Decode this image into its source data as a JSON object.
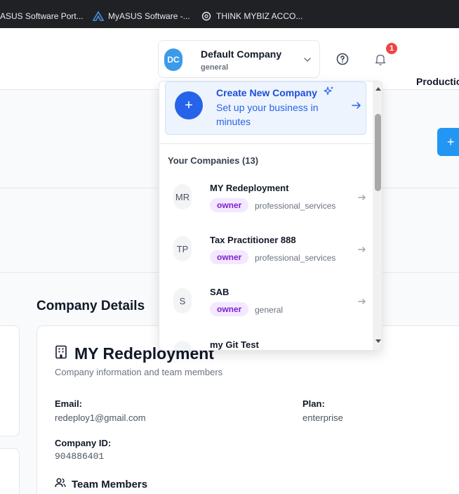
{
  "bookmarks": [
    {
      "label": "ASUS Software Port...",
      "icon": "asus-icon"
    },
    {
      "label": "MyASUS Software -...",
      "icon": "myasus-logo-icon"
    },
    {
      "label": "THINK MYBIZ ACCO...",
      "icon": "openai-icon"
    }
  ],
  "header": {
    "company": {
      "initials": "DC",
      "name": "Default Company",
      "type": "general"
    },
    "notifications_count": "1",
    "app_label": "Productio"
  },
  "dropdown": {
    "create": {
      "title": "Create New Company",
      "subtitle": "Set up your business in minutes"
    },
    "section_title": "Your Companies (13)",
    "companies": [
      {
        "initials": "MR",
        "name": "MY Redeployment",
        "role": "owner",
        "industry": "professional_services"
      },
      {
        "initials": "TP",
        "name": "Tax Practitioner 888",
        "role": "owner",
        "industry": "professional_services"
      },
      {
        "initials": "S",
        "name": "SAB",
        "role": "owner",
        "industry": "general"
      },
      {
        "initials": "",
        "name": "my Git Test",
        "role": "",
        "industry": ""
      }
    ]
  },
  "main": {
    "section_title": "Company Details",
    "card": {
      "title": "MY Redeployment",
      "subtitle": "Company information and team members",
      "email_label": "Email:",
      "email": "redeploy1@gmail.com",
      "plan_label": "Plan:",
      "plan": "enterprise",
      "id_label": "Company ID:",
      "id": "904886401",
      "team_title": "Team Members"
    },
    "add_button_symbol": "+"
  },
  "colors": {
    "primary": "#2563eb",
    "badge": "#ef4444",
    "role_bg": "#f3e8ff",
    "role_text": "#7e22ce"
  }
}
